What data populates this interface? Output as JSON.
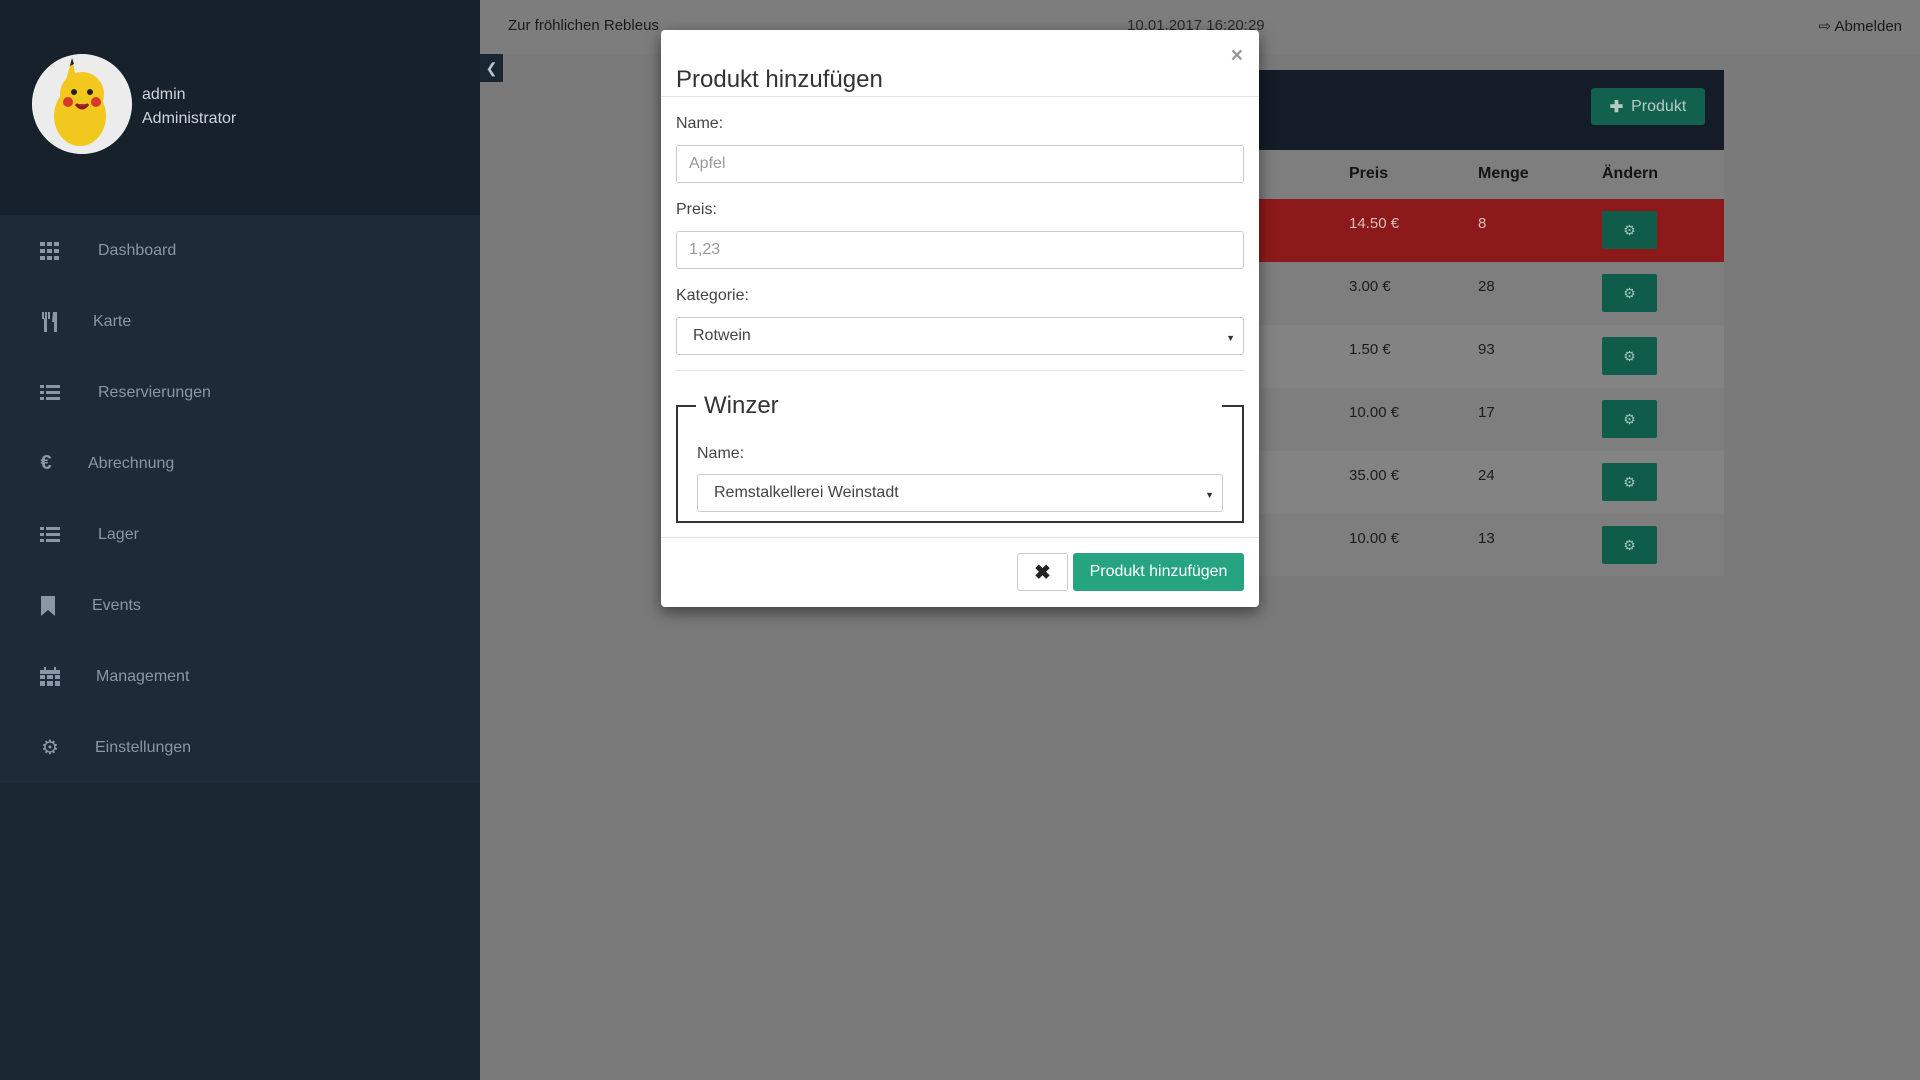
{
  "sidebar": {
    "user": {
      "name": "admin",
      "role": "Administrator"
    },
    "items": [
      {
        "label": "Dashboard",
        "icon": "grid-icon"
      },
      {
        "label": "Karte",
        "icon": "cutlery-icon"
      },
      {
        "label": "Reservierungen",
        "icon": "list-icon"
      },
      {
        "label": "Abrechnung",
        "icon": "euro-icon"
      },
      {
        "label": "Lager",
        "icon": "list-icon"
      },
      {
        "label": "Events",
        "icon": "bookmark-icon"
      },
      {
        "label": "Management",
        "icon": "calendar-icon"
      },
      {
        "label": "Einstellungen",
        "icon": "gear-icon"
      }
    ]
  },
  "topbar": {
    "brand": "Zur fröhlichen Rebleus",
    "datetime": "10.01.2017 16:20:29",
    "logout_label": "Abmelden"
  },
  "panel": {
    "add_button_label": "Produkt",
    "columns": [
      "Preis",
      "Menge",
      "Ändern"
    ],
    "rows": [
      {
        "price": "14.50 €",
        "qty": "8",
        "status": "danger"
      },
      {
        "price": "3.00 €",
        "qty": "28",
        "status": "normal"
      },
      {
        "price": "1.50 €",
        "qty": "93",
        "status": "normal"
      },
      {
        "price": "10.00 €",
        "qty": "17",
        "status": "normal"
      },
      {
        "price": "35.00 €",
        "qty": "24",
        "status": "normal"
      },
      {
        "price": "10.00 €",
        "qty": "13",
        "status": "normal"
      }
    ]
  },
  "modal": {
    "title": "Produkt hinzufügen",
    "close_glyph": "×",
    "name_label": "Name:",
    "name_placeholder": "Apfel",
    "price_label": "Preis:",
    "price_placeholder": "1,23",
    "category_label": "Kategorie:",
    "category_value": "Rotwein",
    "winzer_legend": "Winzer",
    "winzer_name_label": "Name:",
    "winzer_value": "Remstalkellerei Weinstadt",
    "cancel_glyph": "✖",
    "submit_label": "Produkt hinzufügen"
  }
}
